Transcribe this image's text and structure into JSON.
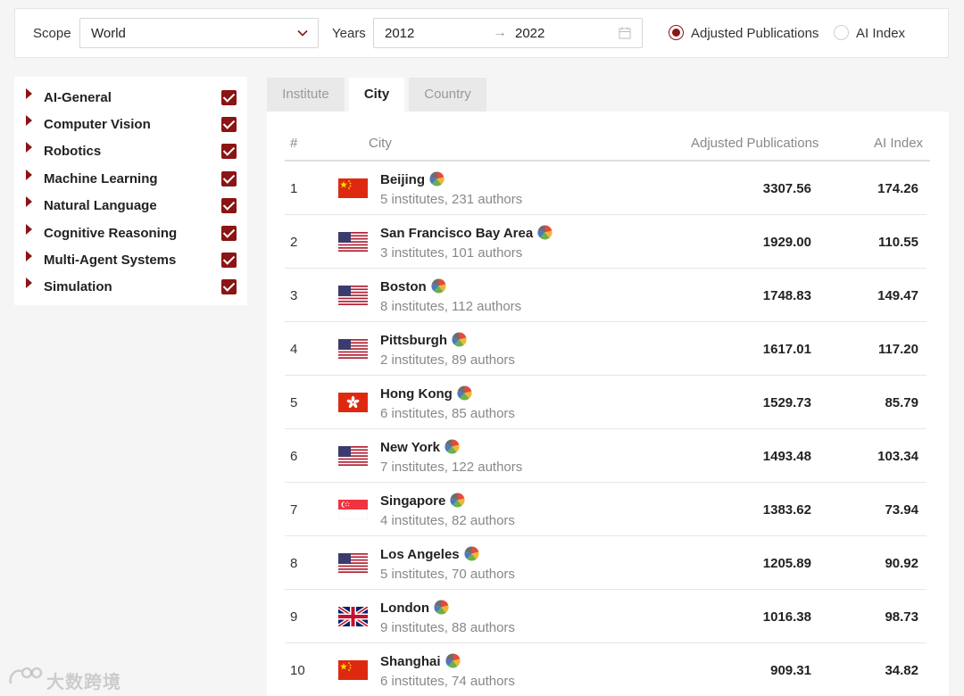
{
  "toolbar": {
    "scope_label": "Scope",
    "scope_value": "World",
    "years_label": "Years",
    "year_start": "2012",
    "year_arrow": "→",
    "year_end": "2022",
    "metric_options": [
      {
        "label": "Adjusted Publications",
        "selected": true
      },
      {
        "label": "AI Index",
        "selected": false
      }
    ]
  },
  "sidebar": {
    "categories": [
      {
        "label": "AI-General",
        "checked": true
      },
      {
        "label": "Computer Vision",
        "checked": true
      },
      {
        "label": "Robotics",
        "checked": true
      },
      {
        "label": "Machine Learning",
        "checked": true
      },
      {
        "label": "Natural Language",
        "checked": true
      },
      {
        "label": "Cognitive Reasoning",
        "checked": true
      },
      {
        "label": "Multi-Agent Systems",
        "checked": true
      },
      {
        "label": "Simulation",
        "checked": true
      }
    ]
  },
  "tabs": [
    {
      "label": "Institute",
      "active": false
    },
    {
      "label": "City",
      "active": true
    },
    {
      "label": "Country",
      "active": false
    }
  ],
  "table": {
    "columns": [
      "#",
      "City",
      "Adjusted Publications",
      "AI Index"
    ],
    "rows": [
      {
        "rank": "1",
        "flag": "china-flag",
        "city": "Beijing",
        "detail": "5 institutes, 231 authors",
        "pubs": "3307.56",
        "index": "174.26"
      },
      {
        "rank": "2",
        "flag": "usa-flag",
        "city": "San Francisco Bay Area",
        "detail": "3 institutes, 101 authors",
        "pubs": "1929.00",
        "index": "110.55"
      },
      {
        "rank": "3",
        "flag": "usa-flag",
        "city": "Boston",
        "detail": "8 institutes, 112 authors",
        "pubs": "1748.83",
        "index": "149.47"
      },
      {
        "rank": "4",
        "flag": "usa-flag",
        "city": "Pittsburgh",
        "detail": "2 institutes, 89 authors",
        "pubs": "1617.01",
        "index": "117.20"
      },
      {
        "rank": "5",
        "flag": "hongkong-flag",
        "city": "Hong Kong",
        "detail": "6 institutes, 85 authors",
        "pubs": "1529.73",
        "index": "85.79"
      },
      {
        "rank": "6",
        "flag": "usa-flag",
        "city": "New York",
        "detail": "7 institutes, 122 authors",
        "pubs": "1493.48",
        "index": "103.34"
      },
      {
        "rank": "7",
        "flag": "singapore-flag",
        "city": "Singapore",
        "detail": "4 institutes, 82 authors",
        "pubs": "1383.62",
        "index": "73.94"
      },
      {
        "rank": "8",
        "flag": "usa-flag",
        "city": "Los Angeles",
        "detail": "5 institutes, 70 authors",
        "pubs": "1205.89",
        "index": "90.92"
      },
      {
        "rank": "9",
        "flag": "uk-flag",
        "city": "London",
        "detail": "9 institutes, 88 authors",
        "pubs": "1016.38",
        "index": "98.73"
      },
      {
        "rank": "10",
        "flag": "china-flag",
        "city": "Shanghai",
        "detail": "6 institutes, 74 authors",
        "pubs": "909.31",
        "index": "34.82"
      }
    ]
  },
  "watermark": {
    "text": "大数跨境"
  },
  "colors": {
    "accent": "#8b1414",
    "muted_text": "#888888",
    "tab_inactive_bg": "#e9e9e9"
  }
}
